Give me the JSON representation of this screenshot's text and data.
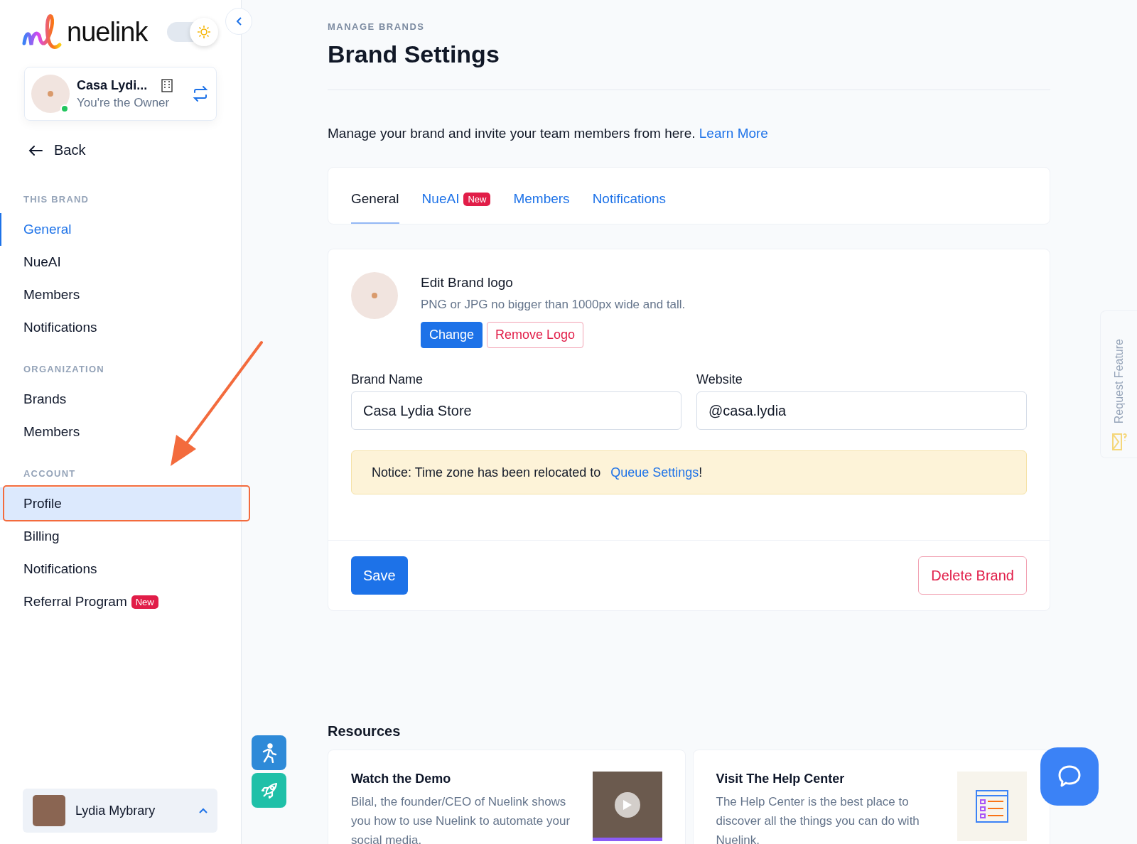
{
  "sidebar": {
    "logo": "nuelink",
    "theme_toggle": {
      "on": true
    },
    "brand": {
      "name": "Casa Lydi...",
      "role": "You're the Owner",
      "online": true
    },
    "back": "Back",
    "sections": [
      {
        "heading": "THIS BRAND",
        "items": [
          {
            "label": "General",
            "selected": true,
            "highlighted": false
          },
          {
            "label": "NueAI",
            "selected": false,
            "highlighted": false
          },
          {
            "label": "Members",
            "selected": false,
            "highlighted": false
          },
          {
            "label": "Notifications",
            "selected": false,
            "highlighted": false
          }
        ]
      },
      {
        "heading": "ORGANIZATION",
        "items": [
          {
            "label": "Brands",
            "selected": false,
            "highlighted": false
          },
          {
            "label": "Members",
            "selected": false,
            "highlighted": false
          }
        ]
      },
      {
        "heading": "ACCOUNT",
        "items": [
          {
            "label": "Profile",
            "selected": false,
            "highlighted": true
          },
          {
            "label": "Billing",
            "selected": false,
            "highlighted": false
          },
          {
            "label": "Notifications",
            "selected": false,
            "highlighted": false
          },
          {
            "label": "Referral Program",
            "selected": false,
            "highlighted": false,
            "badge": "New"
          }
        ]
      }
    ],
    "user": {
      "name": "Lydia Mybrary"
    }
  },
  "main": {
    "breadcrumb": "MANAGE BRANDS",
    "title": "Brand Settings",
    "description": {
      "text": "Manage your brand and invite your team members from here.",
      "link": "Learn More"
    },
    "tabs": [
      {
        "label": "General",
        "selected": true
      },
      {
        "label": "NueAI",
        "selected": false,
        "badge": "New"
      },
      {
        "label": "Members",
        "selected": false
      },
      {
        "label": "Notifications",
        "selected": false
      }
    ],
    "logo_section": {
      "title": "Edit Brand logo",
      "hint": "PNG or JPG no bigger than 1000px wide and tall.",
      "change": "Change",
      "remove": "Remove Logo"
    },
    "fields": [
      {
        "label": "Brand Name",
        "value": "Casa Lydia Store"
      },
      {
        "label": "Website",
        "value": "@casa.lydia"
      }
    ],
    "notice": {
      "text": "Notice: Time zone has been relocated to",
      "link": "Queue Settings",
      "suffix": "!"
    },
    "save": "Save",
    "delete": "Delete Brand",
    "resources": {
      "heading": "Resources",
      "cards": [
        {
          "kind": "video",
          "title": "Watch the Demo",
          "text": "Bilal, the founder/CEO of Nuelink shows you how to use Nuelink to automate your social media."
        },
        {
          "kind": "illustration",
          "title": "Visit The Help Center",
          "text": "The Help Center is the best place to discover all the things you can do with Nuelink."
        }
      ]
    }
  },
  "request_feature": "Request Feature"
}
